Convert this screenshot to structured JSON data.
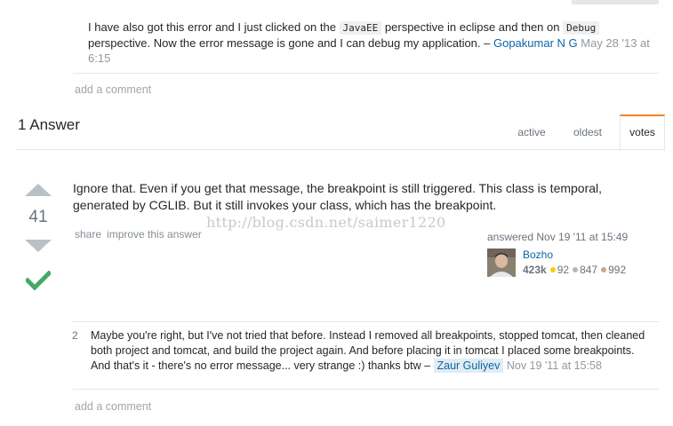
{
  "question_comment": {
    "text_1": "I have also got this error and I just clicked on the ",
    "code_1": "JavaEE",
    "text_2": " perspective in eclipse and then on ",
    "code_2": "Debug",
    "text_3": " perspective. Now the error message is gone and I can debug my application. – ",
    "user": "Gopakumar N G",
    "date": "May 28 '13 at 6:15"
  },
  "add_comment_label": "add a comment",
  "answers": {
    "count_label": "1 Answer",
    "tabs": [
      {
        "label": "active"
      },
      {
        "label": "oldest"
      },
      {
        "label": "votes"
      }
    ]
  },
  "answer": {
    "votes": "41",
    "accepted": true,
    "body": "Ignore that. Even if you get that message, the breakpoint is still triggered. This class is temporal, generated by CGLIB. But it still invokes your class, which has the breakpoint.",
    "menu": {
      "share": "share",
      "improve": "improve this answer"
    },
    "answered_label": "answered Nov 19 '11 at 15:49",
    "author": {
      "name": "Bozho",
      "reputation": "423k",
      "gold": "92",
      "silver": "847",
      "bronze": "992"
    },
    "comment": {
      "score": "2",
      "text": "Maybe you're right, but I've not tried that before. Instead I removed all breakpoints, stopped tomcat, then cleaned both project and tomcat, and build the project again. And before placing it in tomcat I placed some breakpoints. And that's it - there's no error message... very strange :) thanks btw – ",
      "user": "Zaur Guliyev",
      "date": "Nov 19 '11 at 15:58"
    }
  },
  "watermark": "http://blog.csdn.net/saimer1220",
  "colors": {
    "accent_tab": "#f48024",
    "link": "#0c65a5",
    "accepted": "#48a868",
    "gold": "#ffcc01",
    "silver": "#b4b8bc",
    "bronze": "#d1a684"
  }
}
